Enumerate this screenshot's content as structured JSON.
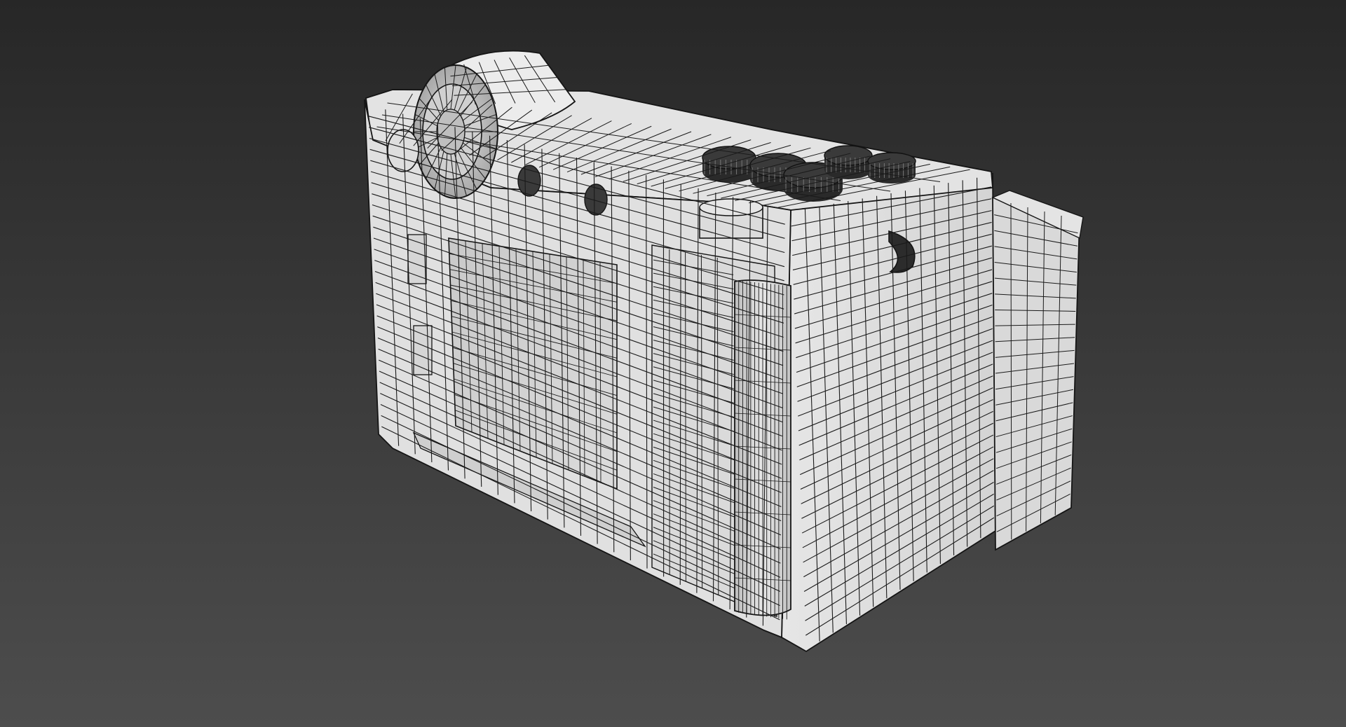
{
  "viewport": {
    "background_top": "#272727",
    "background_bottom": "#4d4d4d",
    "mesh_fill_light": "#e8e8e8",
    "mesh_fill_mid": "#d2d2d2",
    "mesh_fill_shadow": "#bdbdbd",
    "wire_color": "#1a1a1a",
    "shading_mode": "edged-faces",
    "view": "perspective"
  },
  "model": {
    "icon": "camera-body-wireframe-mesh",
    "parts": [
      "camera-back-panel",
      "lcd-screen-recess",
      "right-side-panel",
      "top-plate",
      "lens-barrel",
      "viewfinder-eyepiece",
      "top-dials",
      "thumb-grip",
      "strap-lug",
      "side-buttons"
    ]
  }
}
